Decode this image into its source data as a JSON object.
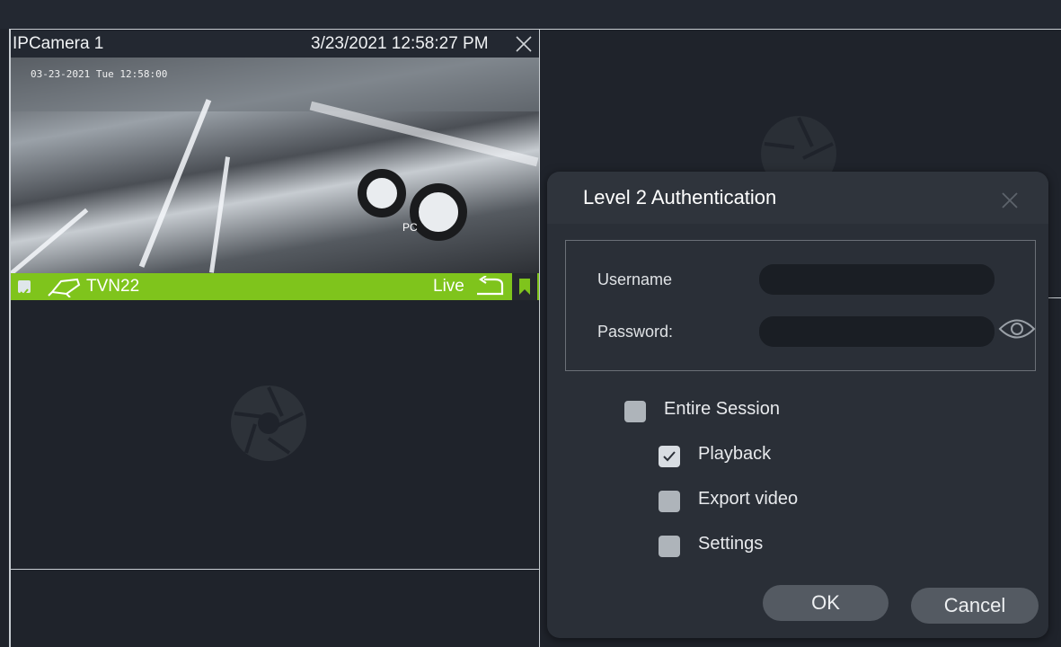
{
  "camera": {
    "name": "IPCamera 1",
    "timestamp": "3/23/2021 12:58:27 PM",
    "video_overlay": "03-23-2021 Tue 12:58:00",
    "device": "TVN22",
    "mode": "Live"
  },
  "dialog": {
    "title": "Level 2 Authentication",
    "username_label": "Username",
    "username_value": "",
    "password_label": "Password:",
    "password_value": "",
    "entire_session": {
      "label": "Entire Session",
      "checked": false
    },
    "options": [
      {
        "label": "Playback",
        "checked": true
      },
      {
        "label": "Export video",
        "checked": false
      },
      {
        "label": "Settings",
        "checked": false
      }
    ],
    "ok_label": "OK",
    "cancel_label": "Cancel"
  },
  "colors": {
    "background": "#1f232b",
    "status_bar": "#7fc41c",
    "dialog": "#2a2f37",
    "button": "#545a62"
  },
  "icons": [
    "close-icon",
    "camera-icon",
    "return-icon",
    "bookmark-icon",
    "aperture-icon",
    "eye-icon",
    "checkmark-icon"
  ]
}
